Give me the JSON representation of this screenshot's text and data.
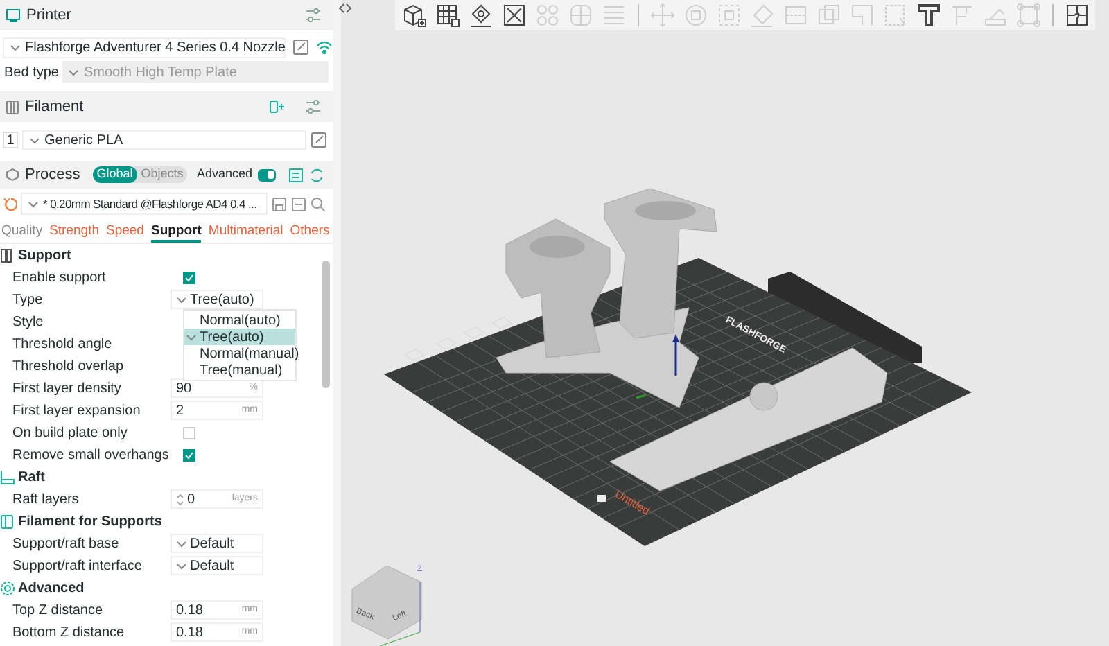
{
  "printer": {
    "title": "Printer",
    "preset": "Flashforge Adventurer 4 Series 0.4 Nozzle",
    "bed_type_label": "Bed type",
    "bed_type": "Smooth High Temp Plate"
  },
  "filament": {
    "title": "Filament",
    "items": [
      {
        "index": "1",
        "name": "Generic PLA"
      }
    ]
  },
  "process": {
    "title": "Process",
    "scope_tabs": [
      {
        "label": "Global",
        "selected": true
      },
      {
        "label": "Objects",
        "selected": false
      }
    ],
    "advanced_label": "Advanced",
    "advanced_on": true,
    "preset": "* 0.20mm Standard @Flashforge AD4 0.4 ..."
  },
  "tabs": [
    {
      "label": "Quality",
      "selected": false
    },
    {
      "label": "Strength",
      "selected": false
    },
    {
      "label": "Speed",
      "selected": false
    },
    {
      "label": "Support",
      "selected": true
    },
    {
      "label": "Multimaterial",
      "selected": false
    },
    {
      "label": "Others",
      "selected": false
    }
  ],
  "sections": [
    {
      "title": "Support",
      "rows": [
        {
          "kind": "checkbox",
          "label": "Enable support",
          "checked": true
        },
        {
          "kind": "select",
          "label": "Type",
          "value": "Tree(auto)"
        },
        {
          "kind": "covered",
          "label": "Style"
        },
        {
          "kind": "covered",
          "label": "Threshold angle"
        },
        {
          "kind": "covered",
          "label": "Threshold overlap"
        },
        {
          "kind": "number",
          "label": "First layer density",
          "value": "90",
          "unit": "%"
        },
        {
          "kind": "number",
          "label": "First layer expansion",
          "value": "2",
          "unit": "mm"
        },
        {
          "kind": "checkbox",
          "label": "On build plate only",
          "checked": false
        },
        {
          "kind": "checkbox",
          "label": "Remove small overhangs",
          "checked": true
        }
      ]
    },
    {
      "title": "Raft",
      "rows": [
        {
          "kind": "spin",
          "label": "Raft layers",
          "value": "0",
          "unit": "layers"
        }
      ]
    },
    {
      "title": "Filament for Supports",
      "rows": [
        {
          "kind": "select",
          "label": "Support/raft base",
          "value": "Default"
        },
        {
          "kind": "select",
          "label": "Support/raft interface",
          "value": "Default"
        }
      ]
    },
    {
      "title": "Advanced",
      "rows": [
        {
          "kind": "number",
          "label": "Top Z distance",
          "value": "0.18",
          "unit": "mm"
        },
        {
          "kind": "number",
          "label": "Bottom Z distance",
          "value": "0.18",
          "unit": "mm"
        }
      ]
    }
  ],
  "dropdown": {
    "options": [
      {
        "label": "Normal(auto)",
        "selected": false
      },
      {
        "label": "Tree(auto)",
        "selected": true
      },
      {
        "label": "Normal(manual)",
        "selected": false
      },
      {
        "label": "Tree(manual)",
        "selected": false
      }
    ]
  },
  "toolbar": [
    {
      "disabled": false
    },
    {
      "disabled": false
    },
    {
      "disabled": false
    },
    {
      "disabled": false
    },
    {
      "disabled": true
    },
    {
      "disabled": true
    },
    {
      "disabled": true
    },
    {
      "disabled": true
    },
    {
      "disabled": true
    },
    {
      "disabled": true
    },
    {
      "disabled": true
    },
    {
      "disabled": true
    },
    {
      "disabled": true
    },
    {
      "disabled": true
    },
    {
      "disabled": true
    },
    {
      "disabled": false
    },
    {
      "disabled": true
    },
    {
      "disabled": true
    },
    {
      "disabled": true
    },
    {
      "disabled": false
    }
  ],
  "viewport": {
    "plate_name": "Untitled",
    "bed_logo": "FLASHFORGE",
    "view_cube": {
      "faces": [
        "Back",
        "Left"
      ],
      "axis": "Z"
    }
  }
}
